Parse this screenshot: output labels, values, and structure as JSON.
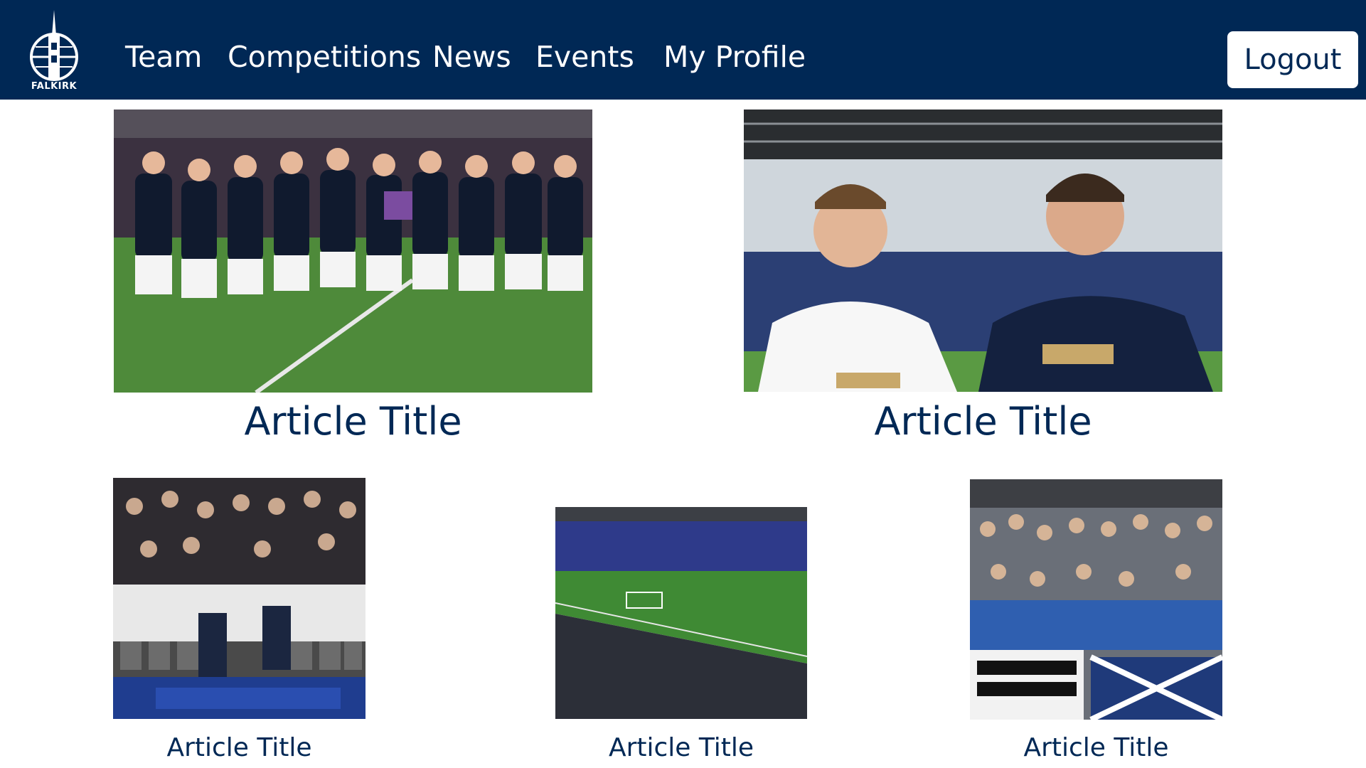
{
  "brand": {
    "logo_icon": "falkirk-steeple-crest-icon",
    "logo_text": "FALKIRK",
    "colors": {
      "navy": "#002855",
      "white": "#ffffff"
    }
  },
  "nav": {
    "items": [
      {
        "label": "Team"
      },
      {
        "label": "Competitions"
      },
      {
        "label": "News"
      },
      {
        "label": "Events"
      },
      {
        "label": "My Profile"
      }
    ],
    "logout_label": "Logout"
  },
  "featured": [
    {
      "title": "Article Title",
      "image": "team-celebration-photo"
    },
    {
      "title": "Article Title",
      "image": "two-players-stadium-photo"
    }
  ],
  "articles": [
    {
      "title": "Article Title",
      "image": "goal-celebration-crowd-photo"
    },
    {
      "title": "Article Title",
      "image": "stadium-pitch-photo"
    },
    {
      "title": "Article Title",
      "image": "fans-with-banners-photo"
    }
  ]
}
